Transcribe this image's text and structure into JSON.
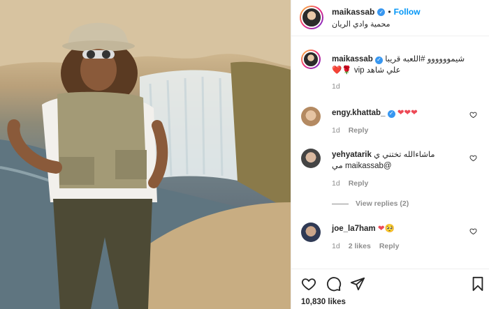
{
  "post": {
    "username": "maikassab",
    "follow_label": "Follow",
    "separator": "•",
    "location": "محمية وادي الريان",
    "caption_username": "maikassab",
    "caption_line1": "شيموووووو #اللعبه قريبا",
    "caption_line2": "علي شاهد vip 🌹❤️",
    "caption_time": "1d",
    "likes_count": "10,830 likes"
  },
  "comments": [
    {
      "username": "engy.khattab_",
      "text": "❤❤❤",
      "time": "1d",
      "reply_label": "Reply"
    },
    {
      "username": "yehyatarik",
      "text": "ماشاءالله تختني ي",
      "text2": "@maikassab مي",
      "time": "1d",
      "reply_label": "Reply",
      "view_replies": "View replies (2)"
    },
    {
      "username": "joe_la7ham",
      "text": "❤🥺",
      "time": "1d",
      "likes": "2 likes",
      "reply_label": "Reply"
    }
  ],
  "icons": {
    "like": "heart-icon",
    "comment": "comment-icon",
    "share": "share-icon",
    "save": "bookmark-icon",
    "verified": "verified-badge-icon"
  },
  "colors": {
    "accent": "#0095f6",
    "verified": "#3897f0",
    "heart": "#ed4956",
    "meta_text": "#8e8e8e"
  }
}
